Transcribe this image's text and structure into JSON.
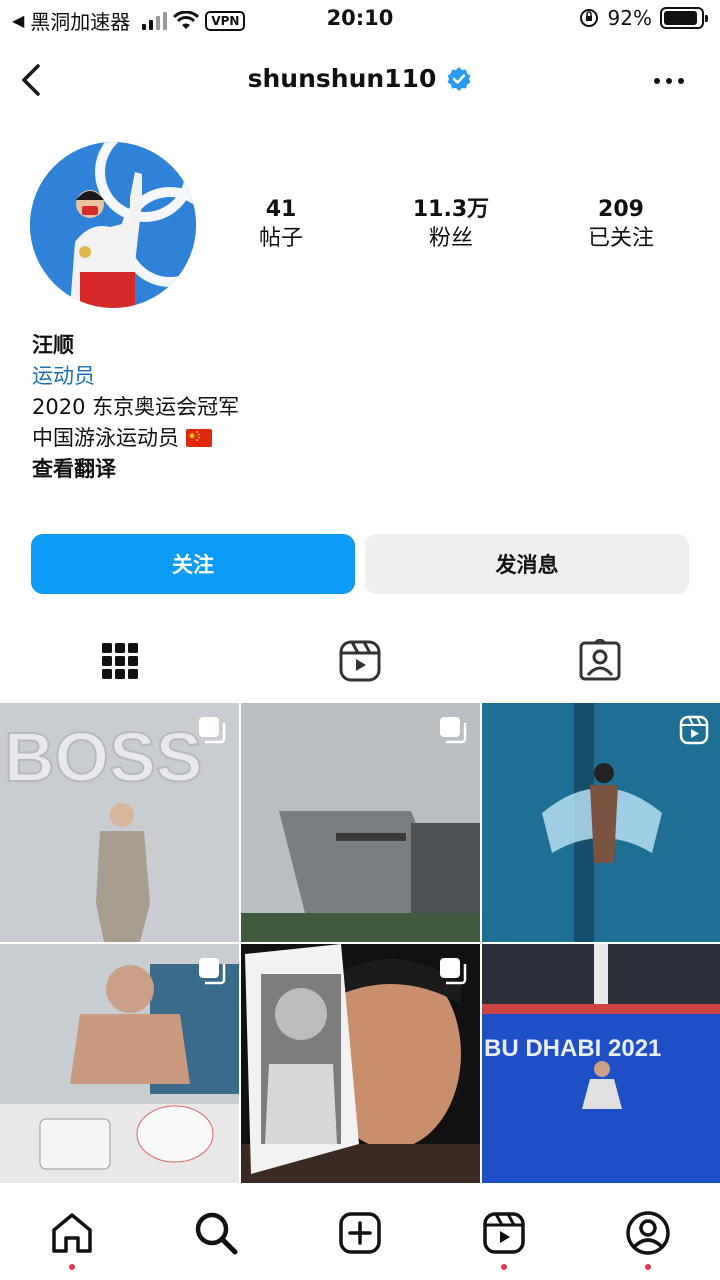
{
  "status_bar": {
    "carrier": "黑洞加速器",
    "vpn": "VPN",
    "time": "20:10",
    "battery": "92%",
    "battery_level": 0.92
  },
  "header": {
    "username": "shunshun110",
    "verified": true,
    "icons": [
      "back-icon",
      "verified-icon",
      "more-icon"
    ]
  },
  "profile": {
    "avatar": "avatar",
    "stats": [
      {
        "value": "41",
        "label": "帖子"
      },
      {
        "value": "11.3万",
        "label": "粉丝"
      },
      {
        "value": "209",
        "label": "已关注"
      }
    ],
    "name": "汪顺",
    "category": "运动员",
    "bio_lines": [
      "2020 东京奥运会冠军",
      "中国游泳运动员"
    ],
    "flag": "🇨🇳",
    "translate": "查看翻译"
  },
  "buttons": {
    "follow": "关注",
    "message": "发消息"
  },
  "tabs": [
    "grid-icon",
    "reels-icon",
    "tagged-icon"
  ],
  "grid": [
    {
      "name": "post-boss-suit",
      "badge": "multi-icon",
      "text": "BOSS"
    },
    {
      "name": "post-building",
      "badge": "multi-icon"
    },
    {
      "name": "post-swimming",
      "badge": "reel-icon"
    },
    {
      "name": "post-birthday-cake",
      "badge": "multi-icon"
    },
    {
      "name": "post-portrait-compare",
      "badge": "multi-icon"
    },
    {
      "name": "post-abu-dhabi",
      "badge": "none",
      "text": "BU DHABI 2021"
    }
  ],
  "bottom_nav": [
    "home-icon",
    "search-icon",
    "create-icon",
    "reels-icon",
    "profile-icon"
  ],
  "colors": {
    "accent": "#0d9cf5",
    "link": "#1c6fb3",
    "notification_dot": "#f0334f",
    "secondary_button": "#efefef"
  }
}
